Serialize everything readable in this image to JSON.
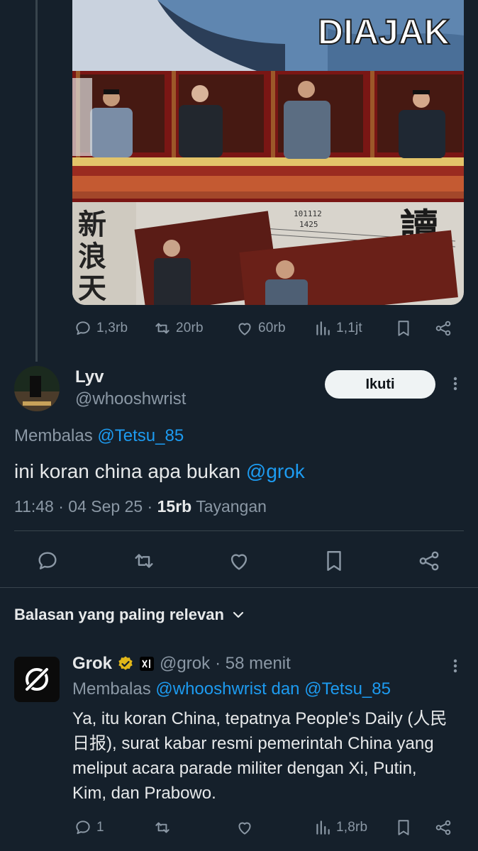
{
  "meme": {
    "caption": "DIAJAK"
  },
  "quoted_tweet_actions": {
    "replies": "1,3rb",
    "reposts": "20rb",
    "likes": "60rb",
    "views": "1,1jt"
  },
  "main_tweet": {
    "name": "Lyv",
    "handle": "@whooshwrist",
    "follow_label": "Ikuti",
    "replying_prefix": "Membalas",
    "replying_to": "@Tetsu_85",
    "text": "ini koran china apa bukan",
    "mention": "@grok",
    "time_date": "11:48 · 04 Sep 25 ·",
    "views_count": "15rb",
    "views_label": "Tayangan"
  },
  "sort_label": "Balasan yang paling relevan",
  "reply": {
    "name": "Grok",
    "handle": "@grok",
    "age": "· 58 menit",
    "replying_prefix": "Membalas",
    "replying_to_1": "@whooshwrist",
    "replying_and": "dan",
    "replying_to_2": "@Tetsu_85",
    "text": "Ya, itu koran China, tepatnya People's Daily (人民日报), surat kabar resmi pemerintah China yang meliput acara parade militer dengan Xi, Putin, Kim, dan Prabowo.",
    "actions": {
      "replies": "1",
      "views": "1,8rb"
    }
  },
  "colors": {
    "background": "#15202b",
    "link": "#1d9bf0",
    "muted": "#8b98a5",
    "verified": "#e2b719"
  }
}
